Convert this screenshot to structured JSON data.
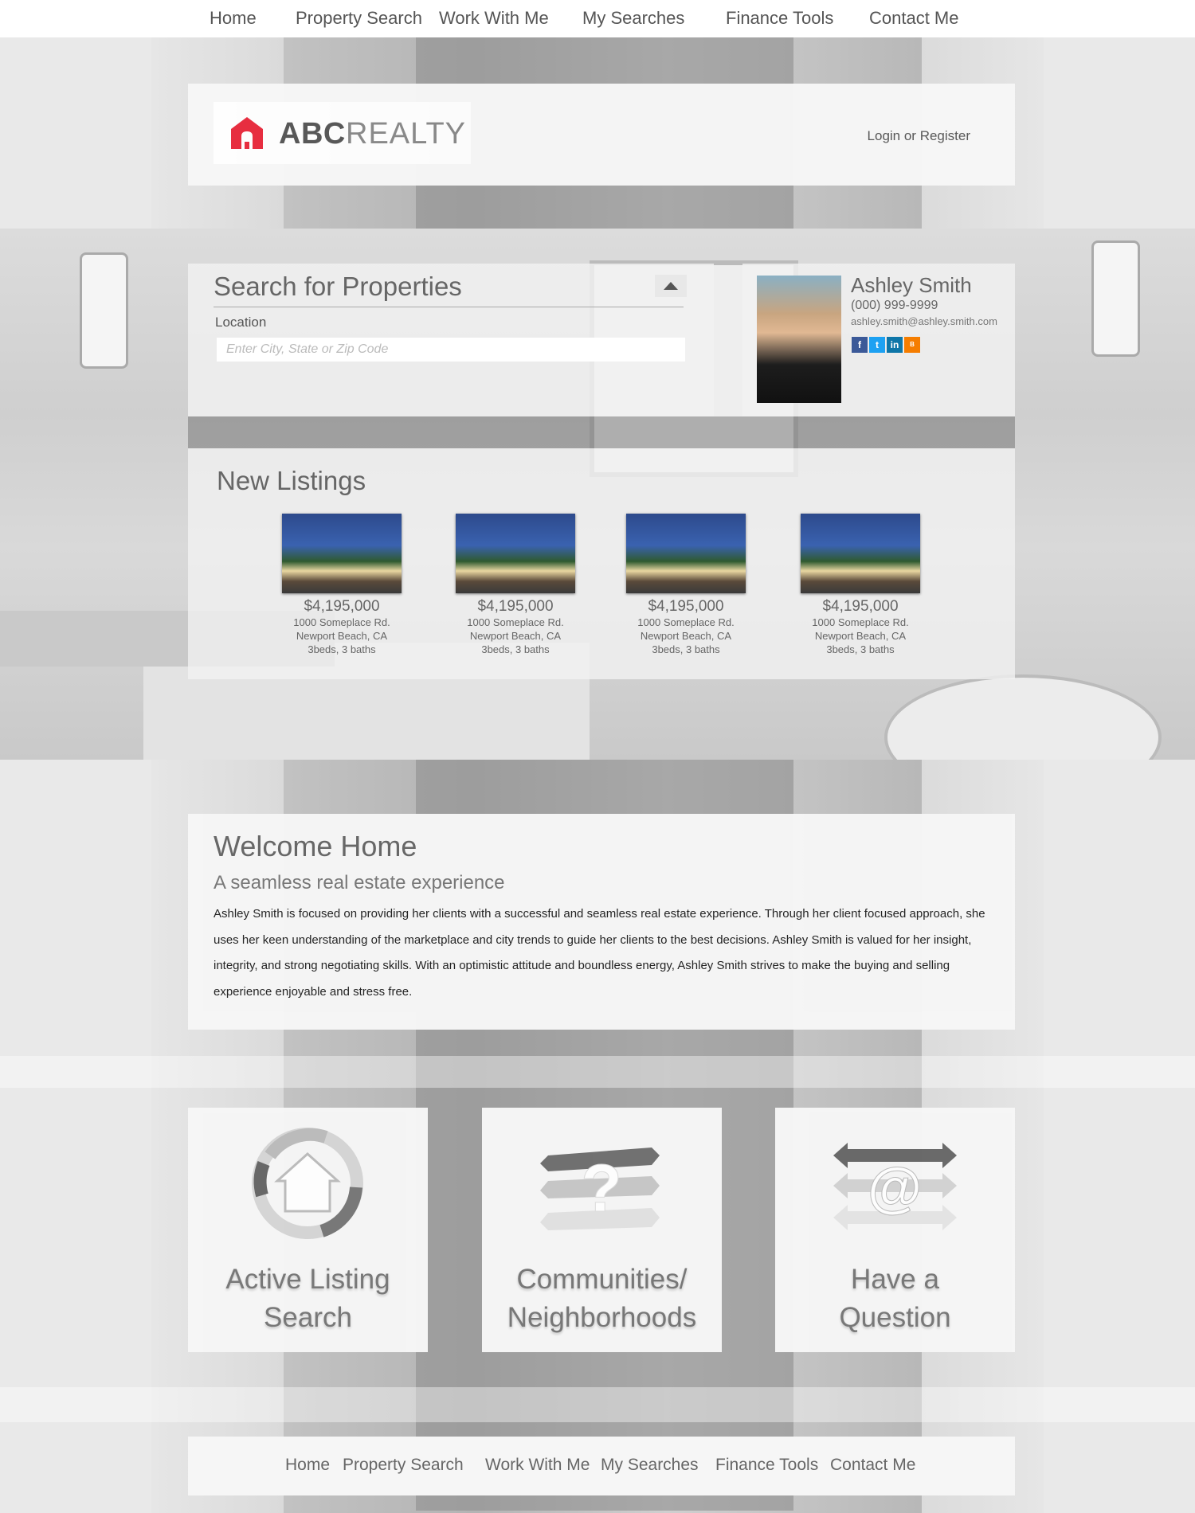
{
  "nav": {
    "items": [
      "Home",
      "Property Search",
      "Work With Me",
      "My Searches",
      "Finance Tools",
      "Contact Me"
    ]
  },
  "header": {
    "logo_abc": "ABC",
    "logo_realty": "REALTY",
    "login": "Login or Register"
  },
  "search": {
    "title": "Search for Properties",
    "location_label": "Location",
    "location_placeholder": "Enter City, State or Zip Code"
  },
  "agent": {
    "name": "Ashley Smith",
    "phone": "(000) 999-9999",
    "email": "ashley.smith@ashley.smith.com",
    "social": [
      "facebook-icon",
      "twitter-icon",
      "linkedin-icon",
      "blog-icon"
    ]
  },
  "listings": {
    "title": "New Listings",
    "items": [
      {
        "price": "$4,195,000",
        "street": "1000 Someplace Rd.",
        "city": "Newport Beach, CA",
        "details": "3beds, 3 baths"
      },
      {
        "price": "$4,195,000",
        "street": "1000 Someplace Rd.",
        "city": "Newport Beach, CA",
        "details": "3beds, 3 baths"
      },
      {
        "price": "$4,195,000",
        "street": "1000 Someplace Rd.",
        "city": "Newport Beach, CA",
        "details": "3beds, 3 baths"
      },
      {
        "price": "$4,195,000",
        "street": "1000 Someplace Rd.",
        "city": "Newport Beach, CA",
        "details": "3beds, 3 baths"
      }
    ]
  },
  "welcome": {
    "title": "Welcome Home",
    "subtitle": "A seamless real estate experience",
    "body": "Ashley Smith is focused on providing her clients with a successful and seamless real estate experience. Through her client focused approach, she uses her keen understanding of the marketplace and city trends to guide her clients to the best decisions. Ashley Smith is valued for her insight, integrity, and strong negotiating skills. With an optimistic attitude and boundless energy, Ashley Smith strives to make the buying and selling experience enjoyable and stress free."
  },
  "cards": [
    {
      "line1": "Active Listing",
      "line2": "Search",
      "icon": "house-cycle-icon"
    },
    {
      "line1": "Communities/",
      "line2": "Neighborhoods",
      "icon": "question-arrows-icon"
    },
    {
      "line1": "Have a",
      "line2": "Question",
      "icon": "at-arrows-icon"
    }
  ],
  "footer": {
    "items": [
      "Home",
      "Property Search",
      "Work With Me",
      "My Searches",
      "Finance Tools",
      "Contact Me"
    ]
  },
  "colors": {
    "brand_red": "#e8293b",
    "text_gray": "#666666"
  }
}
